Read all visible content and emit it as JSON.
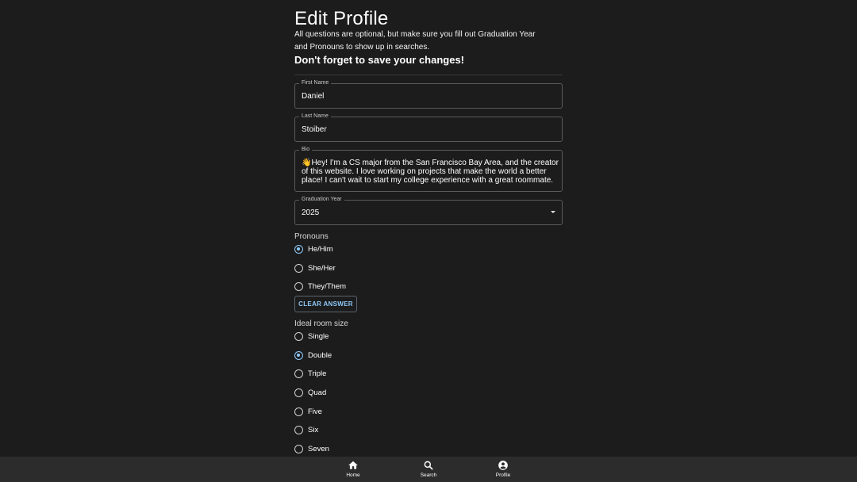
{
  "header": {
    "title": "Edit Profile",
    "intro": "All questions are optional, but make sure you fill out Graduation Year and Pronouns to show up in searches.",
    "reminder": "Don't forget to save your changes!"
  },
  "fields": {
    "first_name": {
      "label": "First Name",
      "value": "Daniel"
    },
    "last_name": {
      "label": "Last Name",
      "value": "Stoiber"
    },
    "bio": {
      "label": "Bio",
      "value": "👋Hey! I'm a CS major from the San Francisco Bay Area, and the creator of this website. I love working on projects that make the world a better place! I can't wait to start my college experience with a great roommate."
    },
    "graduation_year": {
      "label": "Graduation Year",
      "value": "2025"
    }
  },
  "pronouns": {
    "label": "Pronouns",
    "options": [
      "He/Him",
      "She/Her",
      "They/Them"
    ],
    "selected": "He/Him",
    "clear_label": "CLEAR ANSWER"
  },
  "room_size": {
    "label": "Ideal room size",
    "options": [
      "Single",
      "Double",
      "Triple",
      "Quad",
      "Five",
      "Six",
      "Seven"
    ],
    "selected": "Double"
  },
  "bottom_nav": {
    "items": [
      {
        "label": "Home",
        "icon": "home-icon"
      },
      {
        "label": "Search",
        "icon": "search-icon"
      },
      {
        "label": "Profile",
        "icon": "account-circle-icon"
      }
    ]
  },
  "colors": {
    "background": "#1c1c1c",
    "accent": "#90caf9",
    "nav_background": "#2c2c2c"
  }
}
